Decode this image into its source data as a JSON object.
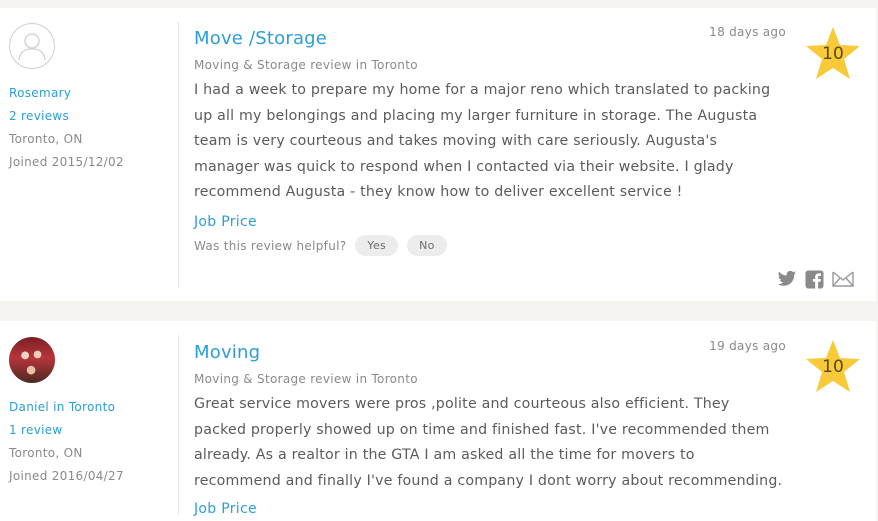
{
  "reviews": [
    {
      "reviewer_name": "Rosemary",
      "reviews_count": "2 reviews",
      "location": "Toronto, ON",
      "joined": "Joined 2015/12/02",
      "title": "Move /Storage",
      "subtitle": "Moving & Storage review in Toronto",
      "date": "18 days ago",
      "score": "10",
      "body": "I had a week to prepare my home for a major reno which translated to packing up all my belongings and placing my larger furniture in storage. The Augusta team is very courteous and takes moving with care seriously. Augusta's manager was quick to respond when I contacted via their website. I glady recommend Augusta - they know how to deliver excellent service !",
      "job_price": "Job Price",
      "helpful_question": "Was this review helpful?",
      "yes_label": "Yes",
      "no_label": "No"
    },
    {
      "reviewer_name": "Daniel in Toronto",
      "reviews_count": "1 review",
      "location": "Toronto, ON",
      "joined": "Joined 2016/04/27",
      "title": "Moving",
      "subtitle": "Moving & Storage review in Toronto",
      "date": "19 days ago",
      "score": "10",
      "body": "Great service movers were pros ,polite and courteous also efficient. They packed properly showed up on time and finished fast. I've recommended them already. As a realtor in the GTA I am asked all the time for movers to recommend and finally I've found a company I dont worry about recommending.",
      "job_price": "Job Price"
    }
  ],
  "colors": {
    "link": "#2c9ed6",
    "star": "#f8c938",
    "text": "#5b5b5b",
    "muted": "#8a8a8a",
    "background": "#f5f4f0"
  },
  "icons": [
    "user-placeholder-icon",
    "star-icon",
    "twitter-icon",
    "facebook-icon",
    "email-icon"
  ]
}
